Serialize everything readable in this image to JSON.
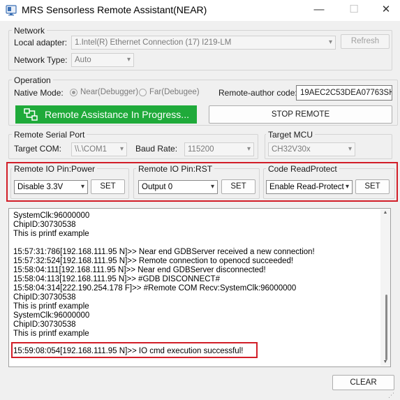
{
  "window": {
    "title": "MRS Sensorless Remote Assistant(NEAR)",
    "minimize": "—",
    "maximize": "☐",
    "close": "✕"
  },
  "network": {
    "legend": "Network",
    "adapter_label": "Local adapter:",
    "adapter_value": "1.Intel(R) Ethernet Connection (17) I219-LM",
    "refresh_label": "Refresh",
    "type_label": "Network Type:",
    "type_value": "Auto"
  },
  "operation": {
    "legend": "Operation",
    "native_mode_label": "Native Mode:",
    "near_option": "Near(Debugger)",
    "far_option": "Far(Debugee)",
    "selected_mode": "near",
    "remote_code_label": "Remote-author code:",
    "remote_code_value": "19AEC2C53DEA07763SH",
    "assist_button": "Remote Assistance In Progress...",
    "stop_button": "STOP REMOTE"
  },
  "serial": {
    "legend": "Remote Serial Port",
    "target_com_label": "Target COM:",
    "target_com_value": "\\\\.\\COM1",
    "baud_label": "Baud Rate:",
    "baud_value": "115200"
  },
  "mcu": {
    "legend": "Target MCU",
    "value": "CH32V30x"
  },
  "io_power": {
    "legend": "Remote IO Pin:Power",
    "value": "Disable 3.3V",
    "set_label": "SET"
  },
  "io_rst": {
    "legend": "Remote IO Pin:RST",
    "value": "Output 0",
    "set_label": "SET"
  },
  "readprotect": {
    "legend": "Code ReadProtect",
    "value": "Enable Read-Protect",
    "set_label": "SET"
  },
  "log": {
    "lines": [
      "SystemClk:96000000",
      "ChipID:30730538",
      "This is printf example",
      "",
      "15:57:31:786[192.168.111.95 N]>> Near end GDBServer received a new connection!",
      "15:57:32:524[192.168.111.95 N]>> Remote connection to openocd succeeded!",
      "15:58:04:111[192.168.111.95 N]>> Near end GDBServer disconnected!",
      "15:58:04:113[192.168.111.95 N]>> #GDB DISCONNECT#",
      "15:58:04:314[222.190.254.178 F]>> #Remote COM Recv:SystemClk:96000000",
      "ChipID:30730538",
      "This is printf example",
      "SystemClk:96000000",
      "ChipID:30730538",
      "This is printf example",
      "",
      "15:59:08:054[192.168.111.95 N]>> IO cmd execution successful!"
    ]
  },
  "footer": {
    "clear_label": "CLEAR"
  },
  "colors": {
    "accent_green": "#1faa3a",
    "highlight_red": "#d21e28"
  }
}
